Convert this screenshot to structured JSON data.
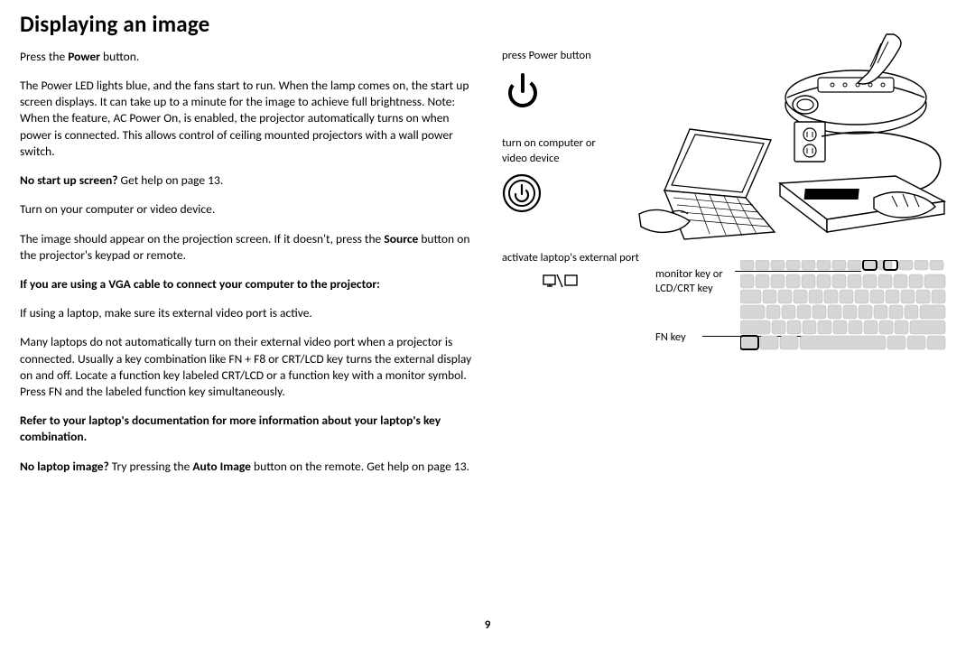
{
  "title": "Displaying an image",
  "left": {
    "p1_pre": "Press the ",
    "p1_bold": "Power",
    "p1_post": " button.",
    "p2": "The Power LED lights blue, and the fans start to run. When the lamp comes on, the start up screen displays. It can take up to a minute for the image to achieve full brightness. Note: When the feature, AC Power On, is enabled, the projector automatically turns on when power is connected. This allows control of ceiling mounted projectors with a wall power switch.",
    "p3_bold": "No start up screen?",
    "p3_post": " Get help on page 13.",
    "p4": "Turn on your computer or video device.",
    "p5_pre": "The image should appear on the projection screen. If it doesn't, press the ",
    "p5_bold": "Source",
    "p5_post": " button on the projector's keypad or remote.",
    "p6": "If you are using a VGA cable to connect your computer to the projector:",
    "p7": "If using a laptop, make sure its external video port is active.",
    "p8": "Many laptops do not automatically turn on their external video port when a projector is connected. Usually a key combination like FN + F8 or CRT/LCD key turns the external display on and off. Locate a function key labeled CRT/LCD or a function key with a monitor symbol. Press FN and the labeled function key simultaneously.",
    "p9": "Refer to your laptop's documentation for more information about your laptop's key combination.",
    "p10_bold": "No laptop image?",
    "p10_mid": " Try pressing the ",
    "p10_bold2": "Auto Image",
    "p10_post": " button on the remote. Get help on page 13."
  },
  "right": {
    "label1": "press Power button",
    "label2": "turn on computer or video device",
    "label3": "activate laptop's external port",
    "kb_label1": "monitor key or LCD/CRT key",
    "kb_label2": "FN key"
  },
  "pagenum": "9"
}
